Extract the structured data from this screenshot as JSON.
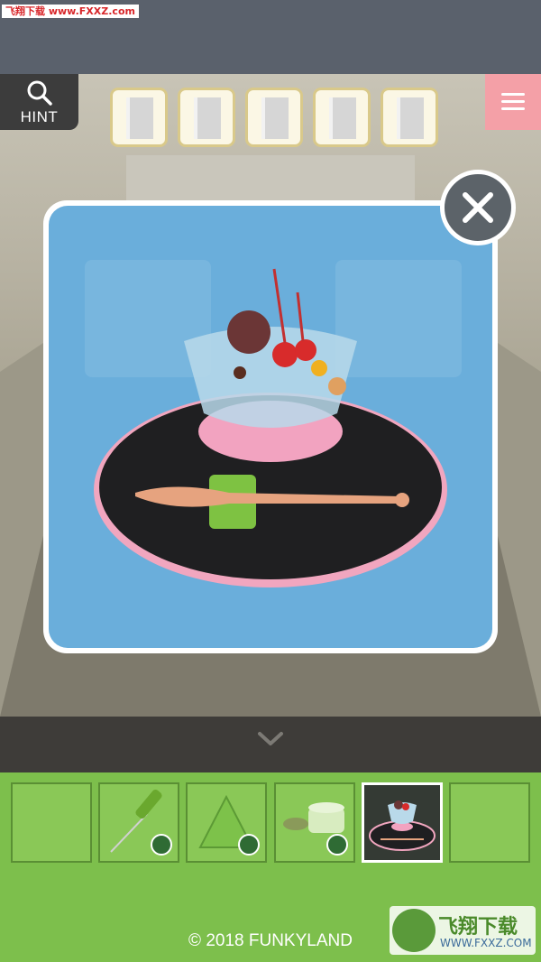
{
  "watermark": {
    "top_text": "飞翔下载 www.FXXZ.com"
  },
  "toolbar": {
    "hint_label": "HINT"
  },
  "item_slots": {
    "count": 5
  },
  "overlay": {
    "item": "anmitsu-dessert-on-tray",
    "close_icon": "close-icon"
  },
  "inventory": {
    "slots": [
      {
        "item": "",
        "checked": false,
        "selected": false
      },
      {
        "item": "green-screwdriver",
        "checked": true,
        "selected": false
      },
      {
        "item": "green-triangle",
        "checked": true,
        "selected": false
      },
      {
        "item": "coin-and-glass-cup",
        "checked": true,
        "selected": false
      },
      {
        "item": "anmitsu-dessert-on-tray",
        "checked": false,
        "selected": true
      },
      {
        "item": "",
        "checked": false,
        "selected": false
      }
    ]
  },
  "footer": {
    "copyright": "© 2018 FUNKYLAND"
  },
  "brand": {
    "name": "飞翔下载",
    "url": "WWW.FXXZ.COM"
  },
  "colors": {
    "inventory_bg": "#7dbf4c",
    "menu_bg": "#f4a0a7",
    "overlay_bg": "#6aaedb"
  }
}
